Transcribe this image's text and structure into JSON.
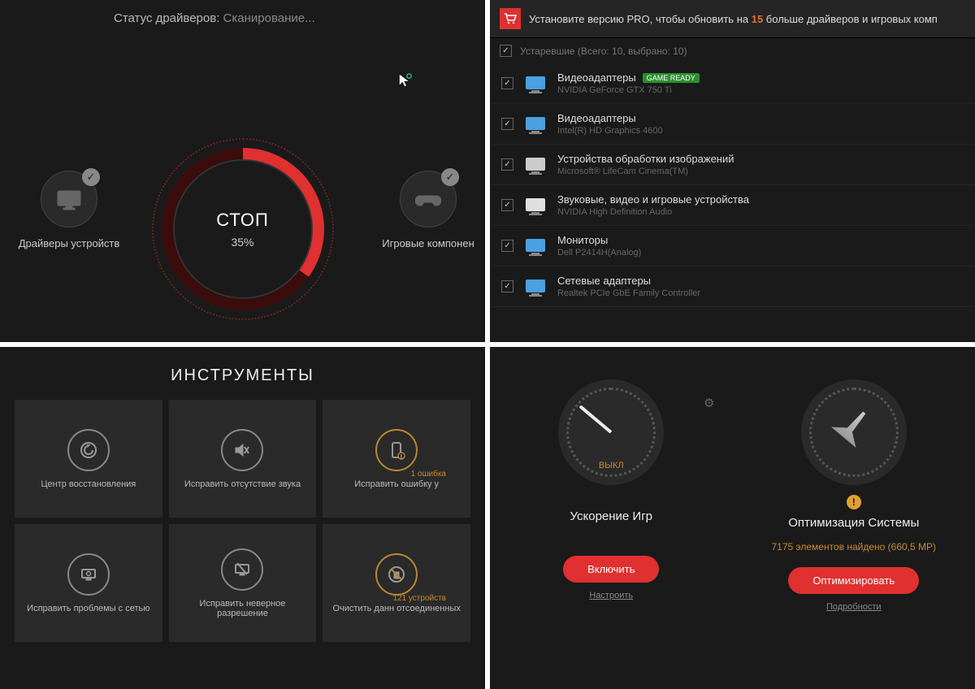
{
  "scanner": {
    "status_label": "Статус драйверов:",
    "status_value": "Сканирование...",
    "stop_label": "СТОП",
    "percent": "35%",
    "left_cat": "Драйверы устройств",
    "right_cat": "Игровые компонен"
  },
  "drivers": {
    "banner_prefix": "Установите версию PRO, чтобы обновить на ",
    "banner_num": "15",
    "banner_suffix": " больше драйверов и игровых комп",
    "group_header": "Устаревшие (Всего: 10, выбрано: 10)",
    "items": [
      {
        "name": "Видеоадаптеры",
        "detail": "NVIDIA GeForce GTX 750 Ti",
        "badge": "GAME READY",
        "color": "#4aa0e0"
      },
      {
        "name": "Видеоадаптеры",
        "detail": "Intel(R) HD Graphics 4600",
        "badge": "",
        "color": "#4aa0e0"
      },
      {
        "name": "Устройства обработки изображений",
        "detail": "Microsoft® LifeCam Cinema(TM)",
        "badge": "",
        "color": "#cccccc"
      },
      {
        "name": "Звуковые, видео и игровые устройства",
        "detail": "NVIDIA High Definition Audio",
        "badge": "",
        "color": "#e0e0e0"
      },
      {
        "name": "Мониторы",
        "detail": "Dell P2414H(Analog)",
        "badge": "",
        "color": "#4aa0e0"
      },
      {
        "name": "Сетевые адаптеры",
        "detail": "Realtek PCIe GbE Family Controller",
        "badge": "",
        "color": "#4aa0e0"
      }
    ]
  },
  "tools": {
    "title": "ИНСТРУМЕНТЫ",
    "items": [
      {
        "label": "Центр восстановления",
        "badge": ""
      },
      {
        "label": "Исправить отсутствие звука",
        "badge": ""
      },
      {
        "label": "Исправить ошибку у",
        "badge": "1 ошибка"
      },
      {
        "label": "Исправить проблемы с сетью",
        "badge": ""
      },
      {
        "label": "Исправить неверное разрешение",
        "badge": ""
      },
      {
        "label": "Очистить данн отсоединенных",
        "badge": "121 устройств"
      }
    ]
  },
  "boost": {
    "game": {
      "gauge_label": "ВЫКЛ",
      "title": "Ускорение Игр",
      "button": "Включить",
      "link": "Настроить"
    },
    "system": {
      "title": "Оптимизация Системы",
      "subtitle": "7175 элементов найдено (660,5 МР)",
      "button": "Оптимизировать",
      "link": "Подробности"
    }
  }
}
